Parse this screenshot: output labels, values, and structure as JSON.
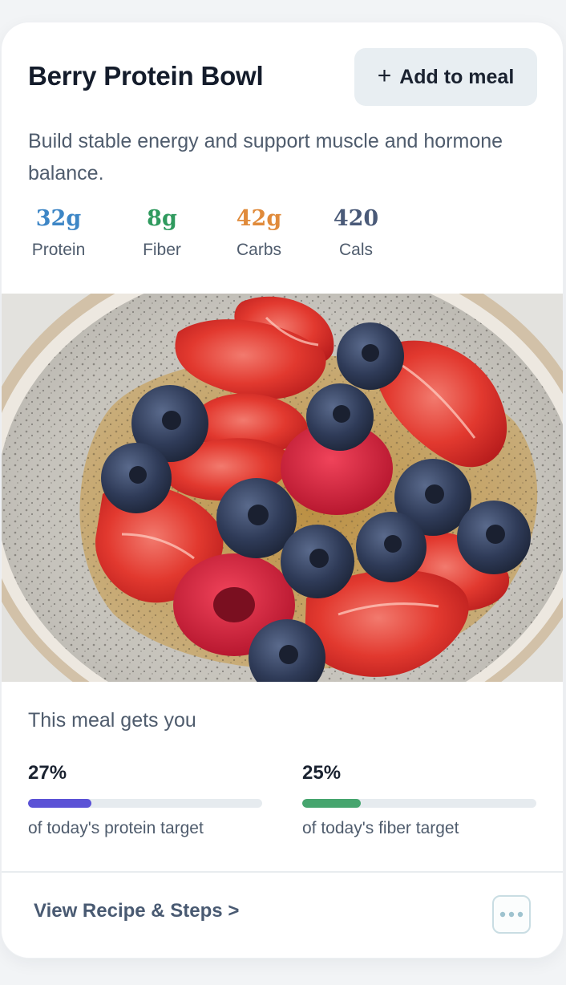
{
  "card": {
    "title": "Berry Protein Bowl",
    "add_button": {
      "icon": "plus-icon",
      "label": "Add to meal"
    },
    "description": "Build stable energy and support muscle and hormone balance.",
    "macros": [
      {
        "value": "32g",
        "label": "Protein",
        "color": "#3d86c6"
      },
      {
        "value": "8g",
        "label": "Fiber",
        "color": "#2f9a5e"
      },
      {
        "value": "42g",
        "label": "Carbs",
        "color": "#e08a3a"
      },
      {
        "value": "420",
        "label": "Cals",
        "color": "#4a5a78"
      }
    ],
    "photo": {
      "subject": "chia pudding bowl with strawberries, blueberries and raspberries"
    }
  },
  "progress": {
    "heading": "This meal gets you",
    "items": [
      {
        "percent_label": "27%",
        "fraction": 0.27,
        "caption": "of today's protein target",
        "color": "#5b52d6"
      },
      {
        "percent_label": "25%",
        "fraction": 0.25,
        "caption": "of today's fiber target",
        "color": "#46a56e"
      }
    ]
  },
  "footer": {
    "recipe_link": "View Recipe & Steps >",
    "more_button": {
      "icon": "more-dots-icon"
    }
  }
}
